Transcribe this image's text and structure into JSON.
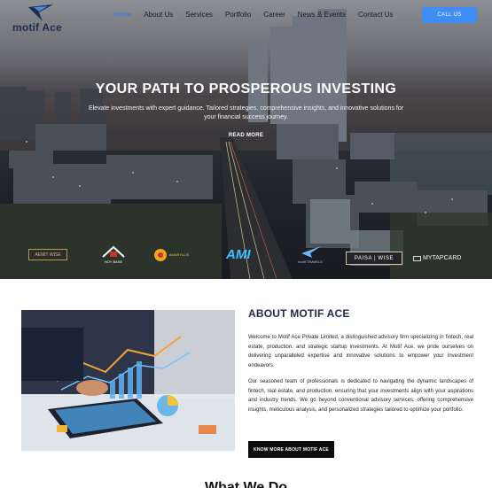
{
  "brand": {
    "name": "motif Ace"
  },
  "nav": {
    "items": [
      {
        "label": "Home",
        "active": true
      },
      {
        "label": "About Us"
      },
      {
        "label": "Services"
      },
      {
        "label": "Portfolio"
      },
      {
        "label": "Career"
      },
      {
        "label": "News & Events"
      },
      {
        "label": "Contact Us"
      }
    ],
    "call_label": "CALL US"
  },
  "hero": {
    "title": "YOUR PATH TO PROSPEROUS INVESTING",
    "subtitle": "Elevate investments with expert guidance. Tailored strategies, comprehensive insights, and innovative solutions for your financial success journey.",
    "read_more": "READ MORE"
  },
  "partners": {
    "aemit": "AEMIT WISE",
    "hoy": "HOY BASE",
    "ama": "AMARYLLIS",
    "ami": "AMI",
    "travels": "motif TRAVELS",
    "paisa": "PAISA | WISE",
    "mytap": "MYTAPCARD"
  },
  "about": {
    "title": "ABOUT MOTIF ACE",
    "para1": "Welcome to Motif Ace Private Limited, a distinguished advisory firm specializing in fintech, real estate, production, and strategic startup investments. At Motif Ace, we pride ourselves on delivering unparalleled expertise and innovative solutions to empower your investment endeavors.",
    "para2": "Our seasoned team of professionals is dedicated to navigating the dynamic landscapes of fintech, real estate, and production, ensuring that your investments align with your aspirations and industry trends. We go beyond conventional advisory services, offering comprehensive insights, meticulous analysis, and personalized strategies tailored to optimize your portfolio.",
    "button": "KNOW MORE ABOUT MOTIF ACE"
  },
  "next_section": {
    "title": "What We Do"
  },
  "colors": {
    "accent": "#3f8ef5",
    "nav_active": "#2f7de1",
    "heading": "#1e2b4a"
  }
}
